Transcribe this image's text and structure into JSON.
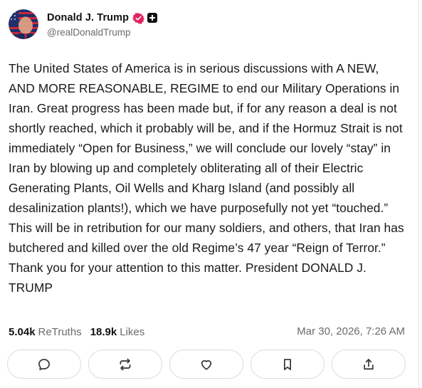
{
  "author": {
    "display_name": "Donald J. Trump",
    "handle": "@realDonaldTrump",
    "avatar_icon": "flag-portrait-avatar",
    "verified_icon": "verified-badge-icon",
    "badge_icon": "plus-badge-icon",
    "verified_color": "#e0245e"
  },
  "post": {
    "text": "The United States of America is in serious discussions with A NEW, AND MORE REASONABLE, REGIME to end our Military Operations in Iran. Great progress has been made but, if for any reason a deal is not shortly reached, which it probably will be, and if the Hormuz Strait is not immediately “Open for Business,” we will conclude our lovely “stay” in Iran by blowing up and completely obliterating all of their Electric Generating Plants, Oil Wells and Kharg Island (and possibly all desalinization plants!), which we have purposefully not yet “touched.” This will be in retribution for our many soldiers, and others, that Iran has butchered and killed over the old Regime’s 47 year “Reign of Terror.” Thank you for your attention to this matter. President DONALD J. TRUMP"
  },
  "stats": {
    "retruths_count": "5.04k",
    "retruths_label": "ReTruths",
    "likes_count": "18.9k",
    "likes_label": "Likes",
    "timestamp": "Mar 30, 2026, 7:26 AM"
  },
  "actions": [
    {
      "name": "reply",
      "icon": "comment-icon"
    },
    {
      "name": "retruth",
      "icon": "repost-icon"
    },
    {
      "name": "like",
      "icon": "heart-icon"
    },
    {
      "name": "bookmark",
      "icon": "bookmark-icon"
    },
    {
      "name": "share",
      "icon": "share-icon"
    }
  ]
}
